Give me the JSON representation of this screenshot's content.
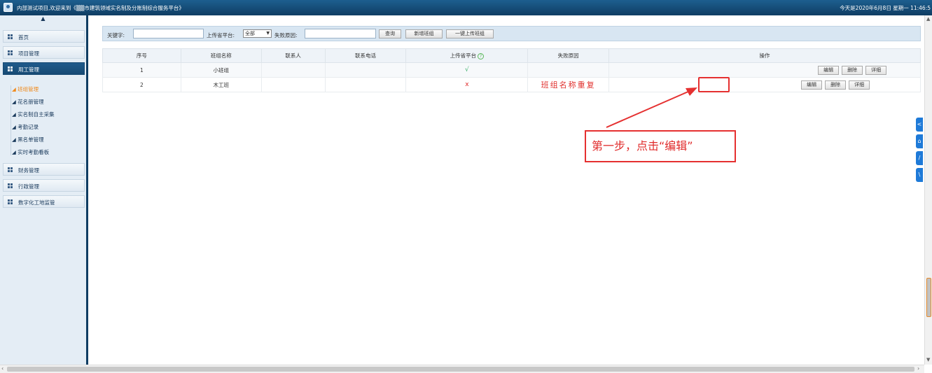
{
  "header": {
    "welcome": "内部测试项目,欢迎来到《▒▒市建筑领域实名制及分账制综合服务平台》",
    "datetime": "今天是2020年6月8日 星期一 11:46:5"
  },
  "sidebar": {
    "collapse_icon": "triangle-up-icon",
    "menus": [
      {
        "label": "首页"
      },
      {
        "label": "项目管理"
      },
      {
        "label": "用工管理"
      },
      {
        "label": "财务管理"
      },
      {
        "label": "行政管理"
      },
      {
        "label": "数字化工地监管"
      }
    ],
    "submenu": [
      {
        "label": "◢ 班组管理"
      },
      {
        "label": "◢ 花名册管理"
      },
      {
        "label": "◢ 实名制自主采集"
      },
      {
        "label": "◢ 考勤记录"
      },
      {
        "label": "◢ 黑名单管理"
      },
      {
        "label": "◢ 实时考勤看板"
      }
    ]
  },
  "search": {
    "keyword_label": "关键字:",
    "keyword_value": "",
    "platform_label": "上传省平台:",
    "platform_selected": "全部",
    "reason_label": "失败原因:",
    "reason_value": "",
    "query_button": "查询",
    "add_button": "新增班组",
    "upload_button": "一键上传班组"
  },
  "table": {
    "columns": [
      "序号",
      "班组名称",
      "联系人",
      "联系电话",
      "上传省平台",
      "失败原因",
      "操作"
    ],
    "help_icon": "?",
    "rows": [
      {
        "index": "1",
        "name": "小班组",
        "contact": "",
        "phone": "",
        "status": "√",
        "reason": ""
      },
      {
        "index": "2",
        "name": "木工班",
        "contact": "",
        "phone": "",
        "status": "x",
        "reason": "班组名称重复"
      }
    ],
    "actions": {
      "edit": "编辑",
      "delete": "删除",
      "detail": "详细"
    }
  },
  "annotation": {
    "callout_text": "第一步，点击“编辑”",
    "color": "#e53030"
  },
  "right_tabs": [
    "<",
    "⌂",
    "/",
    "\\"
  ]
}
